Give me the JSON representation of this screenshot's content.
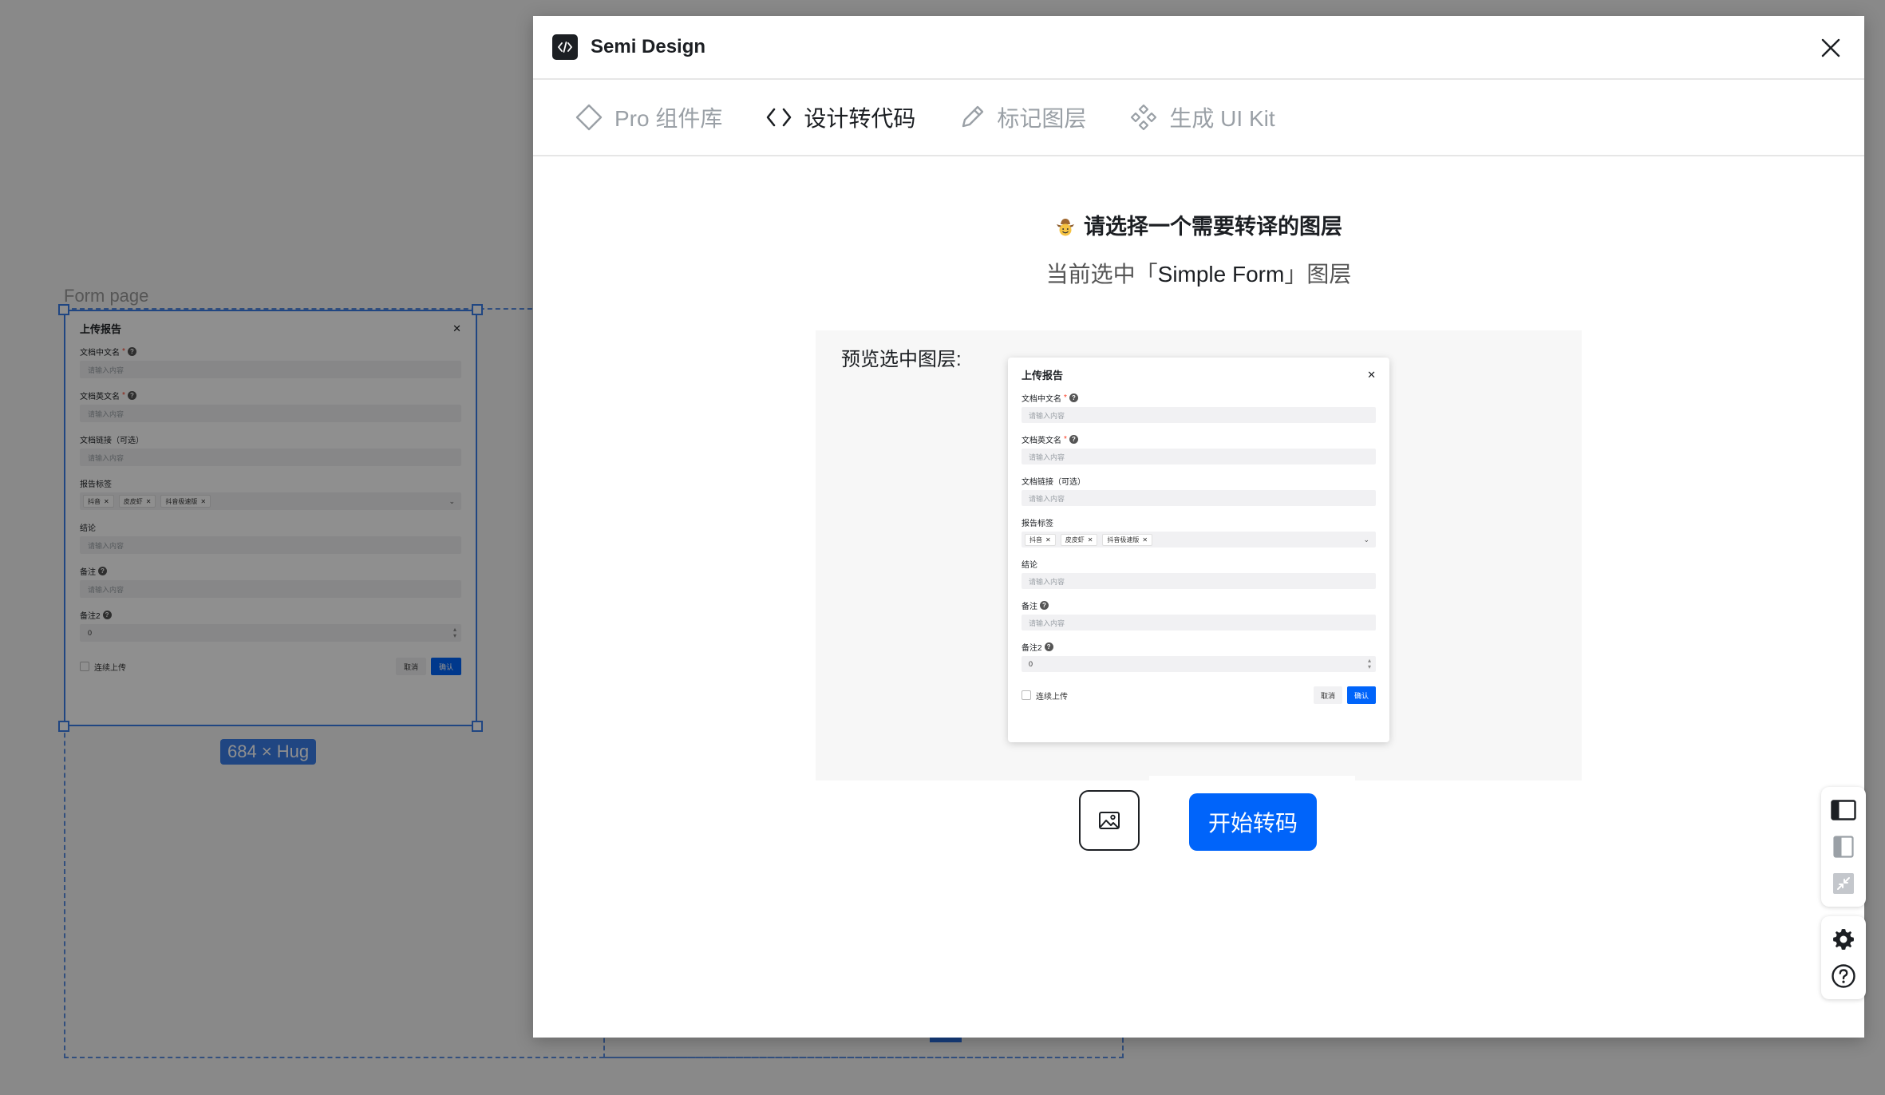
{
  "canvas": {
    "frame_label": "Form page",
    "size_badge": "684 × Hug"
  },
  "form": {
    "title": "上传报告",
    "fields": [
      {
        "label": "文档中文名",
        "required": true,
        "help": true,
        "placeholder": "请输入内容"
      },
      {
        "label": "文档英文名",
        "required": true,
        "help": true,
        "placeholder": "请输入内容"
      },
      {
        "label": "文档链接（可选）",
        "required": false,
        "help": false,
        "placeholder": "请输入内容"
      },
      {
        "label": "报告标签",
        "required": false,
        "help": false,
        "tags": [
          "抖音",
          "皮皮虾",
          "抖音极速版"
        ]
      },
      {
        "label": "结论",
        "required": false,
        "help": false,
        "placeholder": "请输入内容"
      },
      {
        "label": "备注",
        "required": false,
        "help": true,
        "placeholder": "请输入内容"
      },
      {
        "label": "备注2",
        "required": false,
        "help": true,
        "value": "0"
      }
    ],
    "checkbox_label": "连续上传",
    "cancel_label": "取消",
    "ok_label": "确认"
  },
  "plugin": {
    "title": "Semi Design",
    "tabs": [
      {
        "label": "Pro 组件库",
        "icon": "diamond-icon",
        "active": false
      },
      {
        "label": "设计转代码",
        "icon": "code-icon",
        "active": true
      },
      {
        "label": "标记图层",
        "icon": "pencil-icon",
        "active": false
      },
      {
        "label": "生成 UI Kit",
        "icon": "components-icon",
        "active": false
      }
    ],
    "heading": "请选择一个需要转译的图层",
    "subtitle_prefix": "当前选中「",
    "subtitle_layer": "Simple Form",
    "subtitle_suffix": "」图层",
    "preview_label": "预览选中图层:",
    "start_button": "开始转码"
  },
  "colors": {
    "accent": "#0064fa",
    "selection": "#3a7ee8"
  }
}
